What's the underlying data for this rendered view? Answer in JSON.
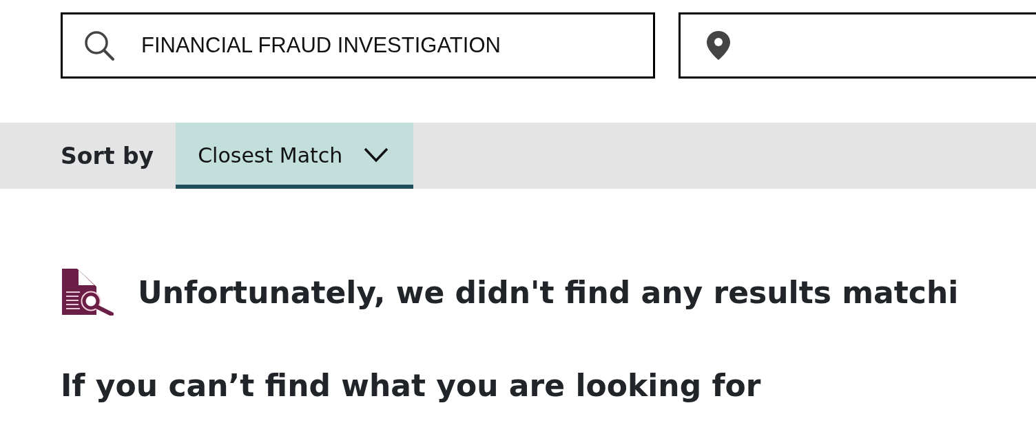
{
  "search": {
    "keyword": {
      "value": "FINANCIAL FRAUD INVESTIGATION"
    }
  },
  "sort": {
    "label": "Sort by",
    "selected_option": "Closest Match"
  },
  "no_results": {
    "message": "Unfortunately, we didn't find any results matchi"
  },
  "help": {
    "heading": "If you can’t find what you are looking for"
  }
}
